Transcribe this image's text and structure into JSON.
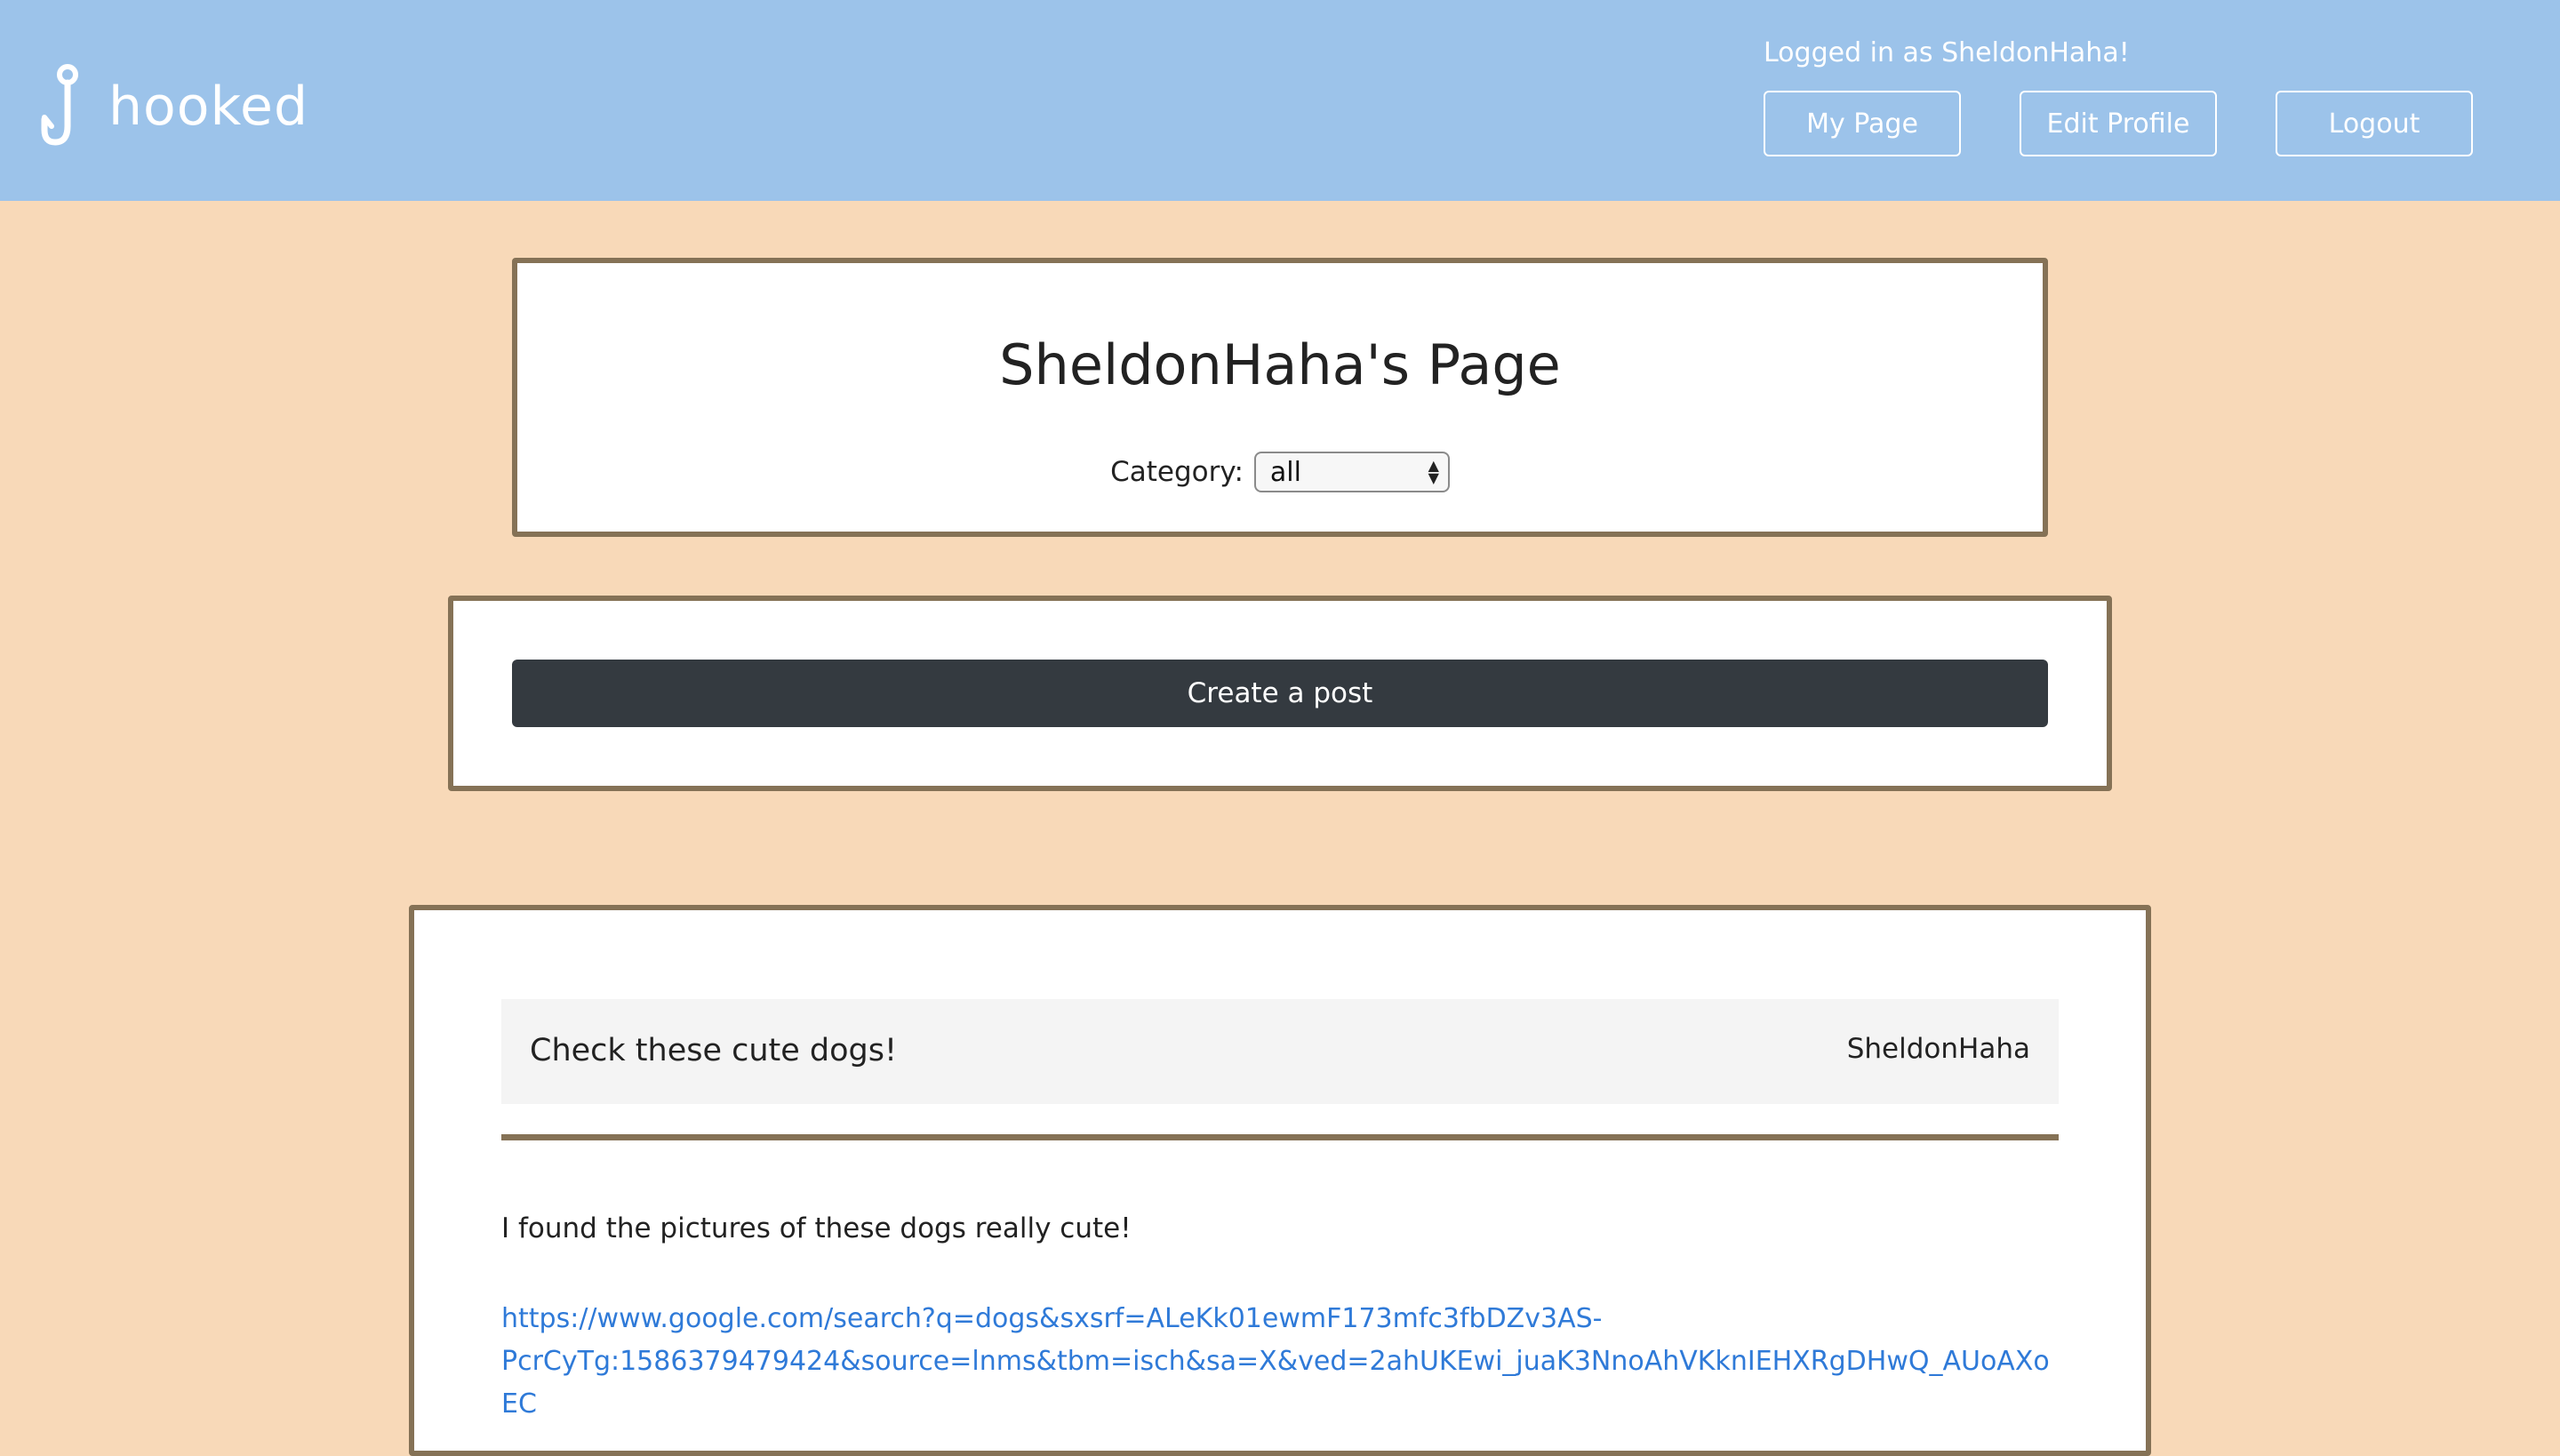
{
  "header": {
    "brand_name": "hooked",
    "login_note": "Logged in as SheldonHaha!",
    "nav": {
      "my_page": "My Page",
      "edit_profile": "Edit Profile",
      "logout": "Logout"
    },
    "colors": {
      "bar": "#9cc3ea",
      "text": "#ffffff"
    },
    "logo_icon": "hook-icon"
  },
  "page": {
    "title": "SheldonHaha's Page",
    "category_label": "Category:",
    "category_selected": "all",
    "background": "#f8d9b8",
    "panel_border": "#857256"
  },
  "create": {
    "button_label": "Create a post",
    "button_color": "#343a40"
  },
  "post": {
    "title": "Check these cute dogs!",
    "author": "SheldonHaha",
    "body": "I found the pictures of these dogs really cute!",
    "link_line1": "https://www.google.com/search?q=dogs&sxsrf=ALeKk01ewmF173mfc3fbDZv3AS-",
    "link_line2": "PcrCyTg:1586379479424&source=lnms&tbm=isch&sa=X&ved=2ahUKEwi_juaK3NnoAhVKknIEHXRgDHwQ_AUoAXoEC",
    "link_color": "#2f7ad8"
  }
}
